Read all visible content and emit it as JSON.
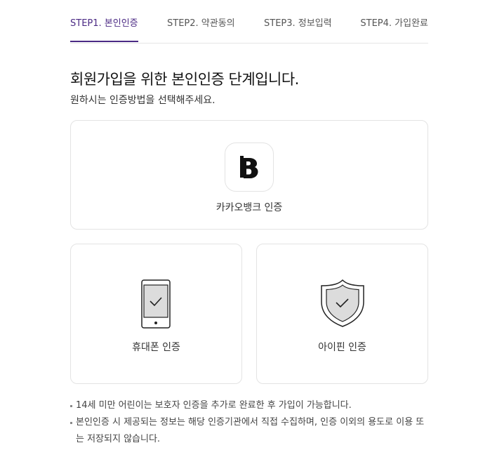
{
  "steps": [
    {
      "label": "STEP1. 본인인증",
      "active": true
    },
    {
      "label": "STEP2. 약관동의",
      "active": false
    },
    {
      "label": "STEP3. 정보입력",
      "active": false
    },
    {
      "label": "STEP4. 가입완료",
      "active": false
    }
  ],
  "heading": {
    "title": "회원가입을 위한 본인인증 단계입니다.",
    "subtitle": "원하시는 인증방법을 선택해주세요."
  },
  "methods": {
    "kakao": {
      "label": "카카오뱅크 인증",
      "icon": "kakaobank-logo-icon"
    },
    "phone": {
      "label": "휴대폰 인증",
      "icon": "smartphone-check-icon"
    },
    "ipin": {
      "label": "아이핀 인증",
      "icon": "shield-check-icon"
    }
  },
  "notes": [
    "14세 미만 어린이는 보호자 인증을 추가로 완료한 후 가입이 가능합니다.",
    "본인인증 시 제공되는 정보는 해당 인증기관에서 직접 수집하며, 인증 이외의 용도로 이용 또는 저장되지 않습니다."
  ],
  "colors": {
    "accent": "#4b2a84",
    "border": "#e3e3e3",
    "icon_fill": "#dcdcdc",
    "icon_stroke": "#222222"
  }
}
